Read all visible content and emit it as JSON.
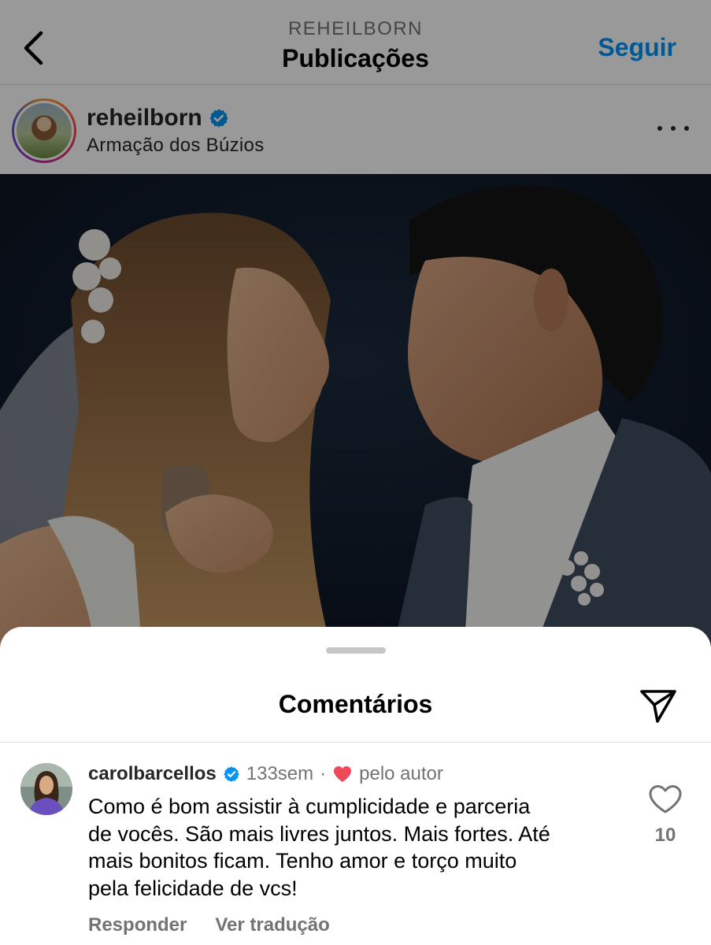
{
  "header": {
    "account_handle": "REHEILBORN",
    "title": "Publicações",
    "follow_label": "Seguir"
  },
  "post": {
    "username": "reheilborn",
    "verified": true,
    "location": "Armação dos Búzios"
  },
  "comments_sheet": {
    "title": "Comentários"
  },
  "comment": {
    "username": "carolbarcellos",
    "verified": true,
    "age": "133sem",
    "separator": "·",
    "liked_by_author_label": "pelo autor",
    "text": "Como é bom assistir à cumplicidade e parceria\nde vocês. São mais livres juntos. Mais fortes. Até\nmais bonitos ficam. Tenho amor  e torço muito\npela felicidade de vcs!",
    "like_count": "10",
    "reply_label": "Responder",
    "translate_label": "Ver tradução"
  },
  "colors": {
    "link_blue": "#0095f6",
    "verified_blue": "#0095f6",
    "heart_red": "#ed4956",
    "secondary_text": "#737373"
  }
}
